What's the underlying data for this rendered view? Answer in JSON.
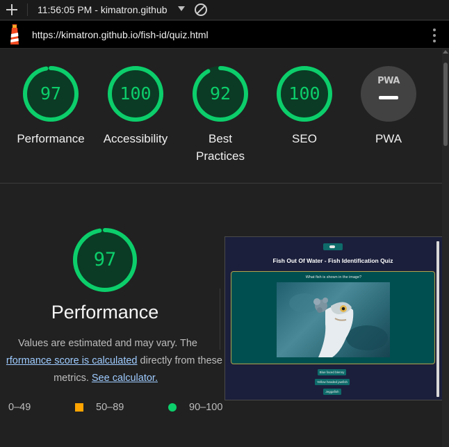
{
  "titlebar": {
    "time": "11:56:05 PM",
    "title_sep": " - ",
    "site": "kimatron.github"
  },
  "urlbar": {
    "url": "https://kimatron.github.io/fish-id/quiz.html"
  },
  "scores": [
    {
      "label": "Performance",
      "value": "97",
      "fraction": 0.97
    },
    {
      "label": "Accessibility",
      "value": "100",
      "fraction": 1.0
    },
    {
      "label": "Best Practices",
      "value": "92",
      "fraction": 0.92
    },
    {
      "label": "SEO",
      "value": "100",
      "fraction": 1.0
    }
  ],
  "pwa": {
    "badge": "PWA",
    "label": "PWA"
  },
  "performance": {
    "score": "97",
    "fraction": 0.97,
    "title": "Performance",
    "desc_line1": "Values are estimated and may vary. The",
    "desc_link": "rformance score is calculated",
    "desc_line2_rest": " directly from these",
    "desc_line3_pre": "metrics. ",
    "calc_link": "See calculator."
  },
  "legend": [
    {
      "range": "0–49",
      "shape": "triangle",
      "color": "#ff4e42"
    },
    {
      "range": "50–89",
      "shape": "square",
      "color": "#ffa400"
    },
    {
      "range": "90–100",
      "shape": "circle",
      "color": "#0cce6b"
    }
  ],
  "thumbnail": {
    "page_title": "Fish Out Of Water - Fish Identification Quiz",
    "question": "What fish is shown in the image?",
    "options": [
      "Blue faced blenny",
      "Yellow headed jawfish",
      "Jeggafish"
    ]
  },
  "colors": {
    "pass": "#0cce6b",
    "pass_bg": "#0b3b24",
    "background": "#212121"
  }
}
